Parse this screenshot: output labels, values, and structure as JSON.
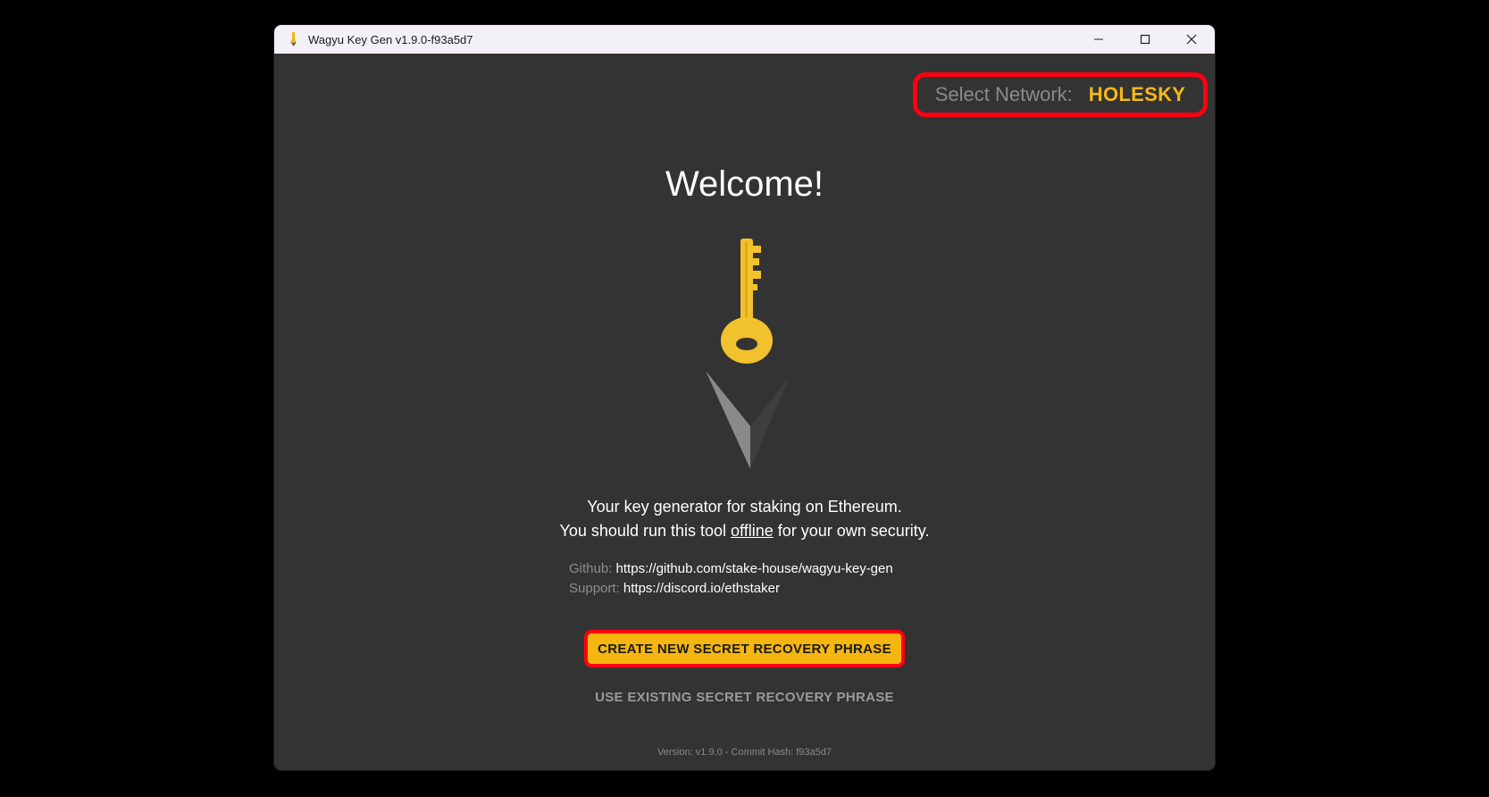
{
  "window": {
    "title": "Wagyu Key Gen v1.9.0-f93a5d7"
  },
  "network": {
    "label": "Select Network:",
    "value": "HOLESKY"
  },
  "main": {
    "heading": "Welcome!",
    "tagline_line1": "Your key generator for staking on Ethereum.",
    "tagline_line2_pre": "You should run this tool ",
    "tagline_line2_emph": "offline",
    "tagline_line2_post": " for your own security.",
    "github_label": "Github:",
    "github_url": "https://github.com/stake-house/wagyu-key-gen",
    "support_label": "Support:",
    "support_url": "https://discord.io/ethstaker",
    "create_button": "CREATE NEW SECRET RECOVERY PHRASE",
    "use_existing_button": "USE EXISTING SECRET RECOVERY PHRASE",
    "version": "Version: v1.9.0 - Commit Hash: f93a5d7"
  },
  "colors": {
    "accent": "#f5b60f",
    "background": "#333333",
    "highlight_border": "#ff0010"
  },
  "icons": [
    "app-logo-icon",
    "minimize-icon",
    "maximize-icon",
    "close-icon",
    "key-logo-icon"
  ]
}
